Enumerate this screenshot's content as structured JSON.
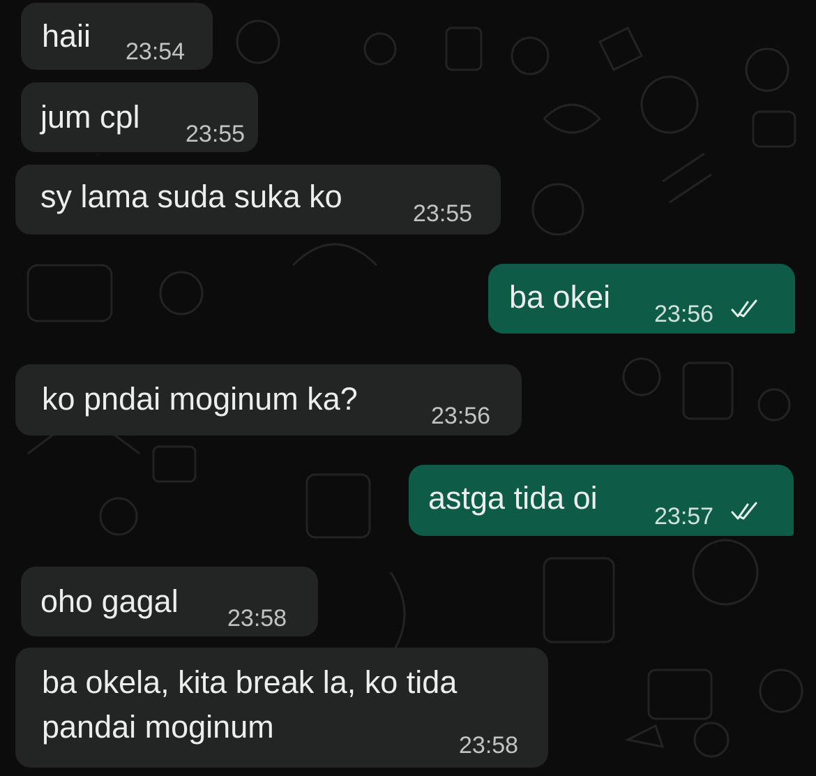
{
  "messages": [
    {
      "direction": "in",
      "text": "haii",
      "time": "23:54"
    },
    {
      "direction": "in",
      "text": "jum cpl",
      "time": "23:55"
    },
    {
      "direction": "in",
      "text": "sy lama suda suka ko",
      "time": "23:55"
    },
    {
      "direction": "out",
      "text": "ba okei",
      "time": "23:56",
      "status": "read-double-check-icon"
    },
    {
      "direction": "in",
      "text": "ko pndai moginum ka?",
      "time": "23:56"
    },
    {
      "direction": "out",
      "text": "astga tida oi",
      "time": "23:57",
      "status": "read-double-check-icon"
    },
    {
      "direction": "in",
      "text": "oho gagal",
      "time": "23:58"
    },
    {
      "direction": "in",
      "text_line1": "ba okela, kita break la, ko tida",
      "text_line2": "pandai moginum",
      "time": "23:58"
    }
  ],
  "colors": {
    "background": "#0b0c0b",
    "incoming_bubble": "#232525",
    "outgoing_bubble": "#0e5b48",
    "text": "#eceeee"
  }
}
